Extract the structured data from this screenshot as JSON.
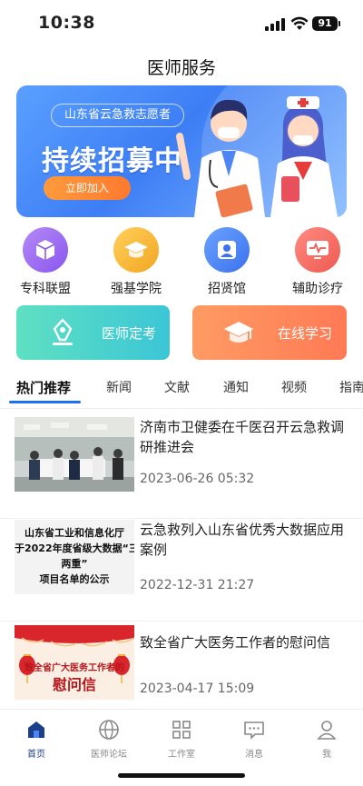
{
  "status_bar": {
    "time": "10:38",
    "battery": "91"
  },
  "page_title": "医师服务",
  "banner": {
    "tag": "山东省云急救志愿者",
    "headline": "持续招募中",
    "cta": "立即加入"
  },
  "categories": [
    {
      "label": "专科联盟",
      "icon": "cube-icon",
      "color": "#a06ef3"
    },
    {
      "label": "强基学院",
      "icon": "graduation-cap-icon",
      "color": "#f5b73b"
    },
    {
      "label": "招贤馆",
      "icon": "user-card-icon",
      "color": "#4d86f4"
    },
    {
      "label": "辅助诊疗",
      "icon": "monitor-pulse-icon",
      "color": "#f06a5f"
    }
  ],
  "actions": [
    {
      "label": "医师定考",
      "icon": "pen-nib-icon"
    },
    {
      "label": "在线学习",
      "icon": "graduation-cap-icon"
    }
  ],
  "tabs": [
    "热门推荐",
    "新闻",
    "文献",
    "通知",
    "视频",
    "指南"
  ],
  "news": [
    {
      "title": "济南市卫健委在千医召开云急救调研推进会",
      "time": "2023-06-26 05:32"
    },
    {
      "title": "云急救列入山东省优秀大数据应用案例",
      "time": "2022-12-31 21:27",
      "thumb_text": [
        "山东省工业和信息化厅",
        "于2022年度省级大数据“三",
        "两重”",
        "项目名单的公示"
      ]
    },
    {
      "title": "致全省广大医务工作者的慰问信",
      "time": "2023-04-17 15:09",
      "thumb_text": [
        "致全省广大医务工作者的",
        "慰问信"
      ]
    }
  ],
  "bottom_nav": [
    {
      "label": "首页",
      "icon": "home-icon",
      "active": true
    },
    {
      "label": "医师论坛",
      "icon": "globe-icon",
      "active": false
    },
    {
      "label": "工作室",
      "icon": "grid-icon",
      "active": false
    },
    {
      "label": "消息",
      "icon": "message-icon",
      "active": false
    },
    {
      "label": "我",
      "icon": "person-icon",
      "active": false
    }
  ]
}
